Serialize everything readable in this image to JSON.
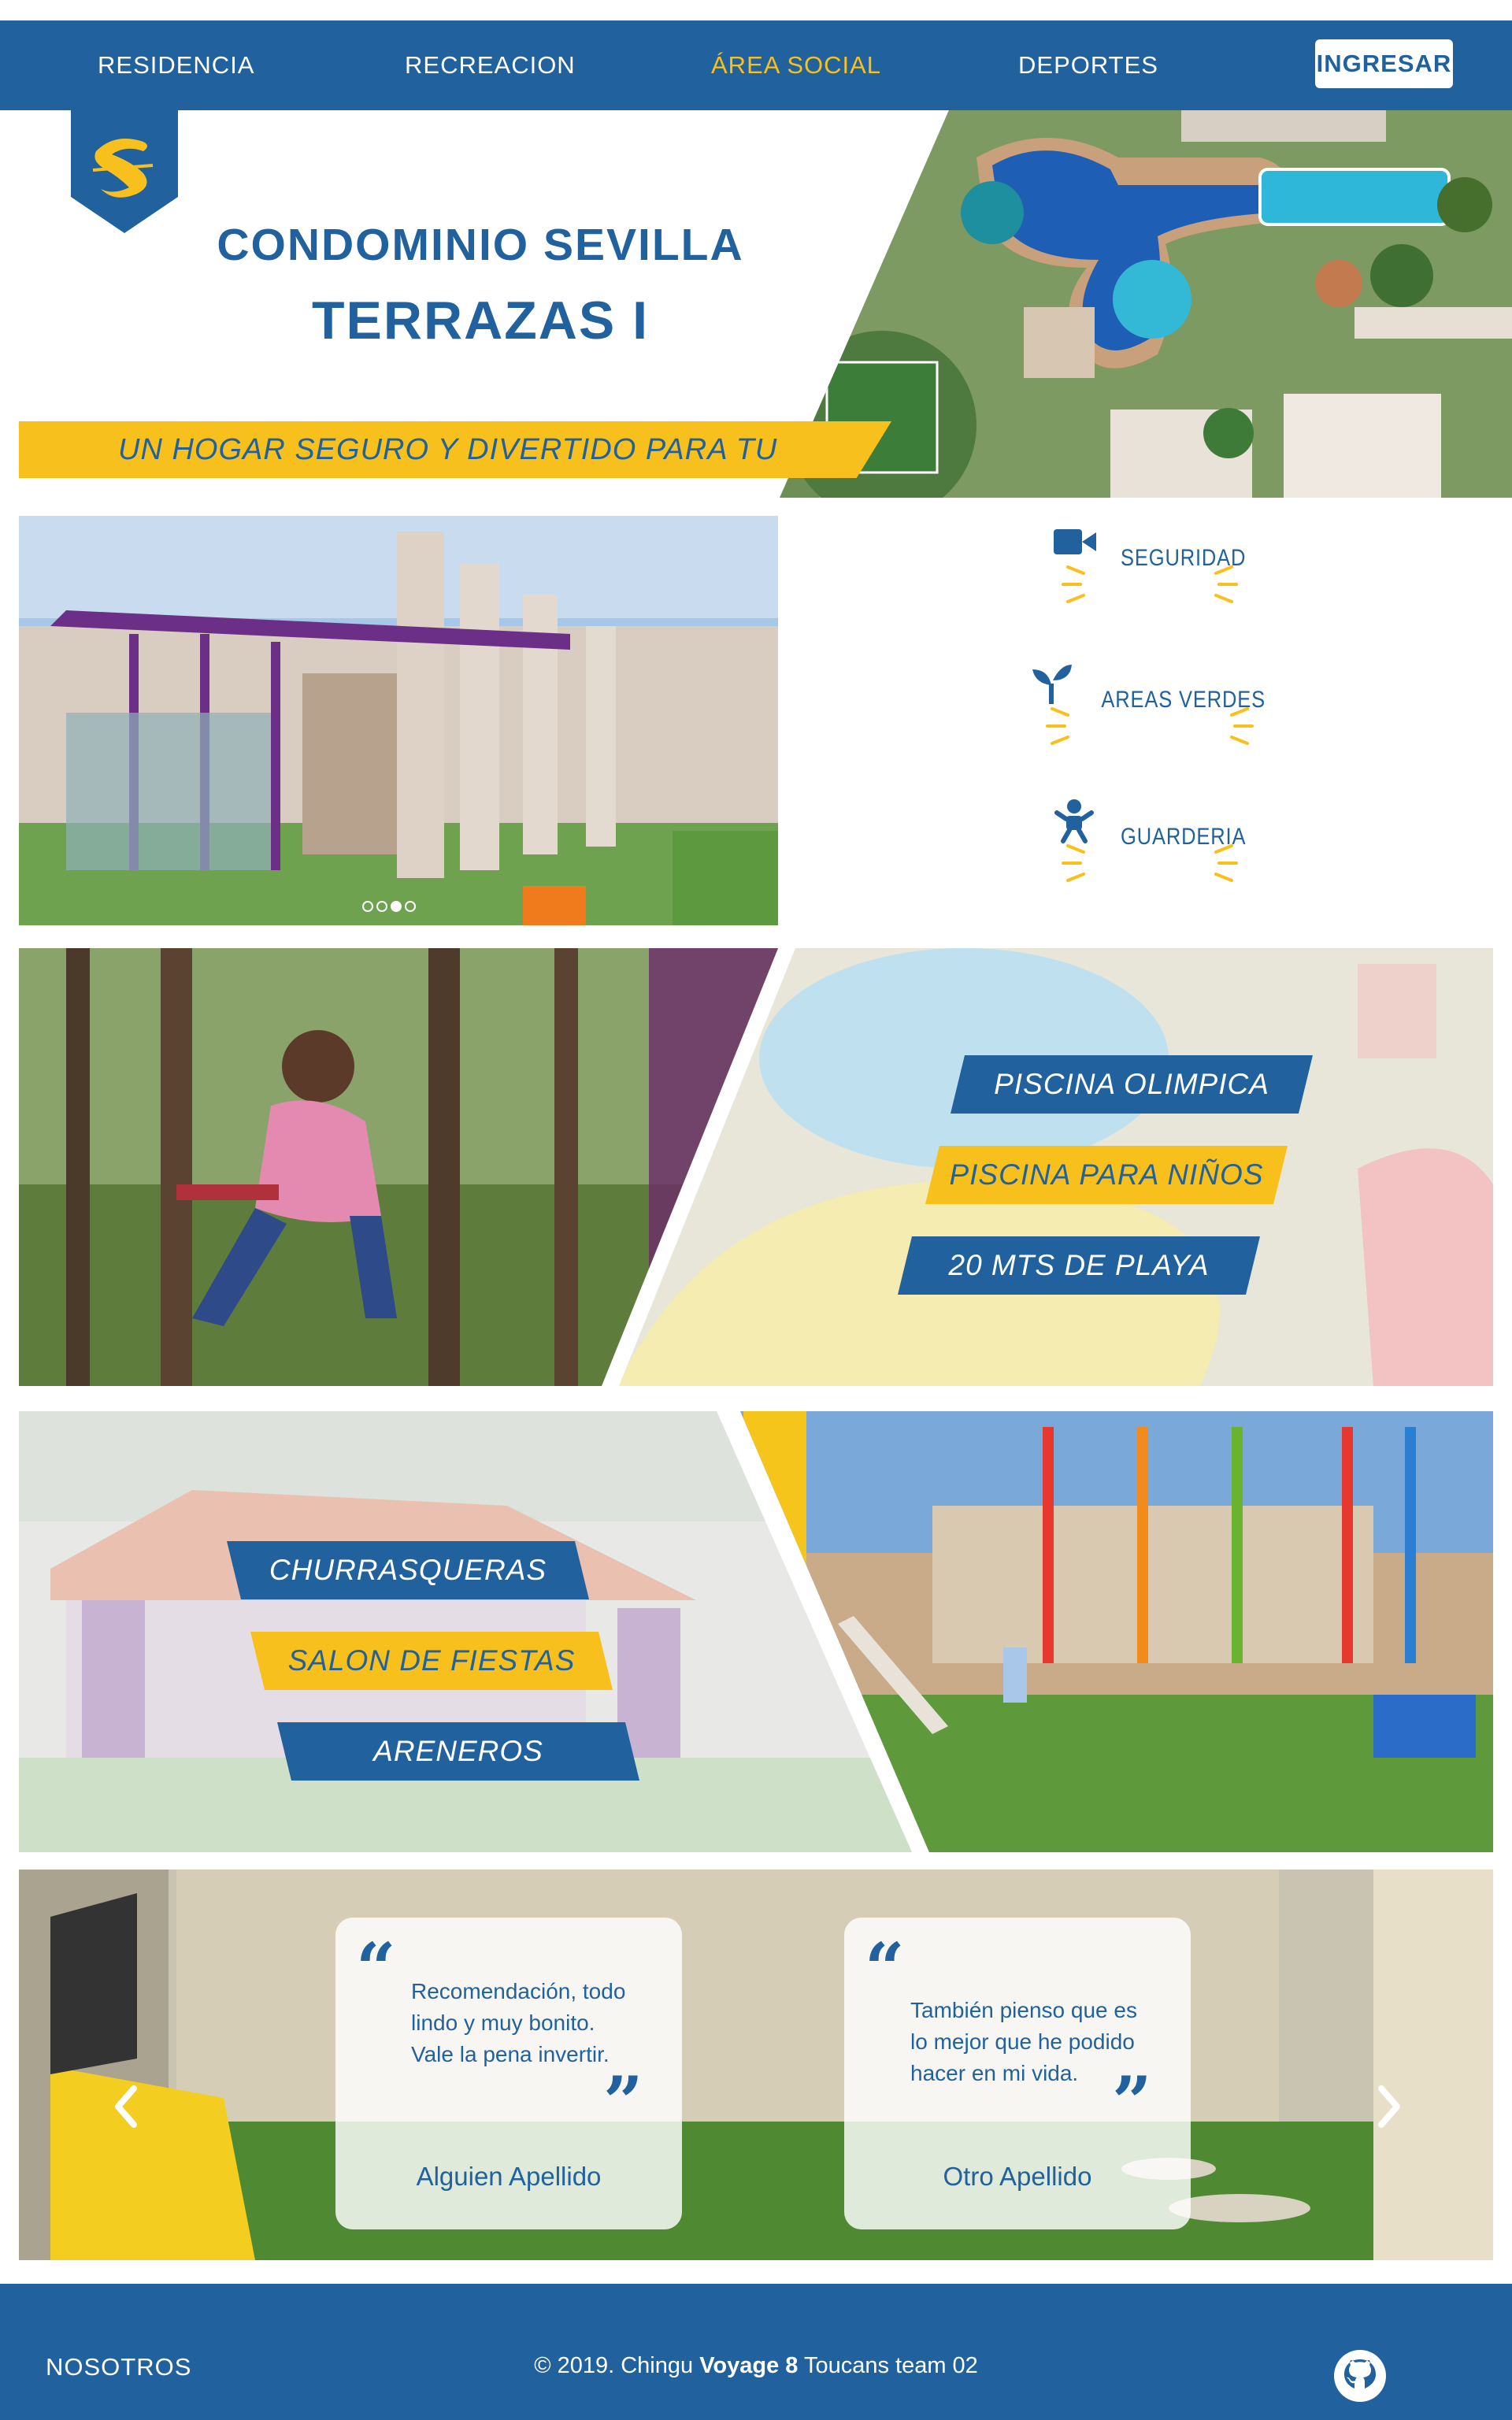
{
  "nav": {
    "items": [
      {
        "label": "RESIDENCIA"
      },
      {
        "label": "RECREACION"
      },
      {
        "label": "ÁREA SOCIAL"
      },
      {
        "label": "DEPORTES"
      }
    ],
    "login_label": "INGRESAR",
    "active_color": "#f8c01c"
  },
  "hero": {
    "title_line1": "CONDOMINIO SEVILLA",
    "title_line2": "TERRAZAS I",
    "slogan": "UN HOGAR SEGURO Y DIVERTIDO PARA TU FAMILIA"
  },
  "features": [
    {
      "label": "SEGURIDAD",
      "icon": "video-camera-icon"
    },
    {
      "label": "AREAS VERDES",
      "icon": "sprout-icon"
    },
    {
      "label": "GUARDERIA",
      "icon": "baby-icon"
    }
  ],
  "carousel": {
    "slides": 4,
    "active_index": 2
  },
  "pools": {
    "banners": [
      "PISCINA OLIMPICA",
      "PISCINA PARA NIÑOS",
      "20 MTS DE PLAYA"
    ]
  },
  "social": {
    "banners": [
      "CHURRASQUERAS",
      "SALON DE FIESTAS",
      "ARENEROS"
    ]
  },
  "testimonials": [
    {
      "text": "Recomendación, todo lindo y muy bonito. Vale la pena invertir.",
      "name": "Alguien Apellido"
    },
    {
      "text": "También pienso que es lo mejor que he podido hacer en mi vida.",
      "name": "Otro Apellido"
    }
  ],
  "footer": {
    "link": "NOSOTROS",
    "copyright_prefix": "© 2019. Chingu",
    "copyright_bold": "Voyage 8",
    "copyright_suffix": "Toucans team 02",
    "icon": "github-icon"
  },
  "colors": {
    "primary": "#21629e",
    "accent": "#f8c01c"
  }
}
